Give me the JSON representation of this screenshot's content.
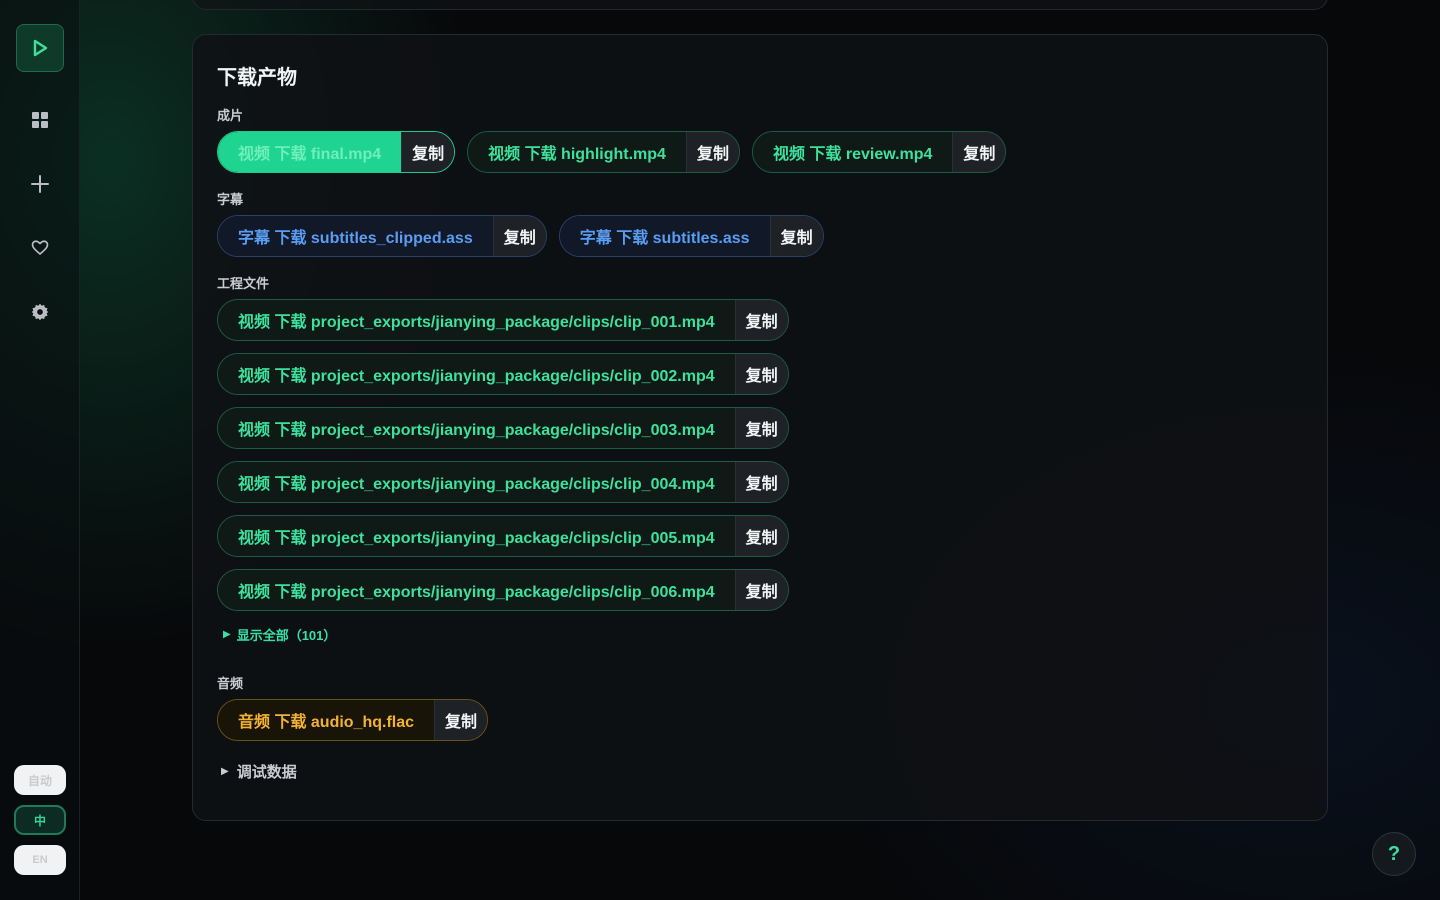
{
  "sidebar": {
    "nav": [
      {
        "icon": "play-icon"
      },
      {
        "icon": "grid-icon"
      },
      {
        "icon": "plus-icon"
      },
      {
        "icon": "heart-icon"
      },
      {
        "icon": "gear-icon"
      }
    ],
    "languages": {
      "auto": "自动",
      "zh": "中",
      "en": "EN"
    }
  },
  "card": {
    "title": "下载产物",
    "sections": {
      "final": {
        "label": "成片",
        "files": [
          {
            "text": "视频 下载 final.mp4",
            "copy": "复制",
            "variant": "active"
          },
          {
            "text": "视频 下载 highlight.mp4",
            "copy": "复制",
            "variant": "green"
          },
          {
            "text": "视频 下载 review.mp4",
            "copy": "复制",
            "variant": "green"
          }
        ]
      },
      "subtitles": {
        "label": "字幕",
        "files": [
          {
            "text": "字幕 下载 subtitles_clipped.ass",
            "copy": "复制",
            "variant": "blue"
          },
          {
            "text": "字幕 下载 subtitles.ass",
            "copy": "复制",
            "variant": "blue"
          }
        ]
      },
      "project": {
        "label": "工程文件",
        "files": [
          {
            "text": "视频 下载 project_exports/jianying_package/clips/clip_001.mp4",
            "copy": "复制"
          },
          {
            "text": "视频 下载 project_exports/jianying_package/clips/clip_002.mp4",
            "copy": "复制"
          },
          {
            "text": "视频 下载 project_exports/jianying_package/clips/clip_003.mp4",
            "copy": "复制"
          },
          {
            "text": "视频 下载 project_exports/jianying_package/clips/clip_004.mp4",
            "copy": "复制"
          },
          {
            "text": "视频 下载 project_exports/jianying_package/clips/clip_005.mp4",
            "copy": "复制"
          },
          {
            "text": "视频 下载 project_exports/jianying_package/clips/clip_006.mp4",
            "copy": "复制"
          }
        ],
        "show_all": "显示全部（101）"
      },
      "audio": {
        "label": "音频",
        "files": [
          {
            "text": "音频 下载 audio_hq.flac",
            "copy": "复制",
            "variant": "amber"
          }
        ]
      }
    },
    "debug_label": "调试数据"
  },
  "help": {
    "label": "?"
  },
  "colors": {
    "accent": "#1fd390",
    "accent_text": "#3ee09c",
    "subtitle_blue": "#5b9df2",
    "audio_amber": "#f2b233",
    "background": "#07080a"
  }
}
